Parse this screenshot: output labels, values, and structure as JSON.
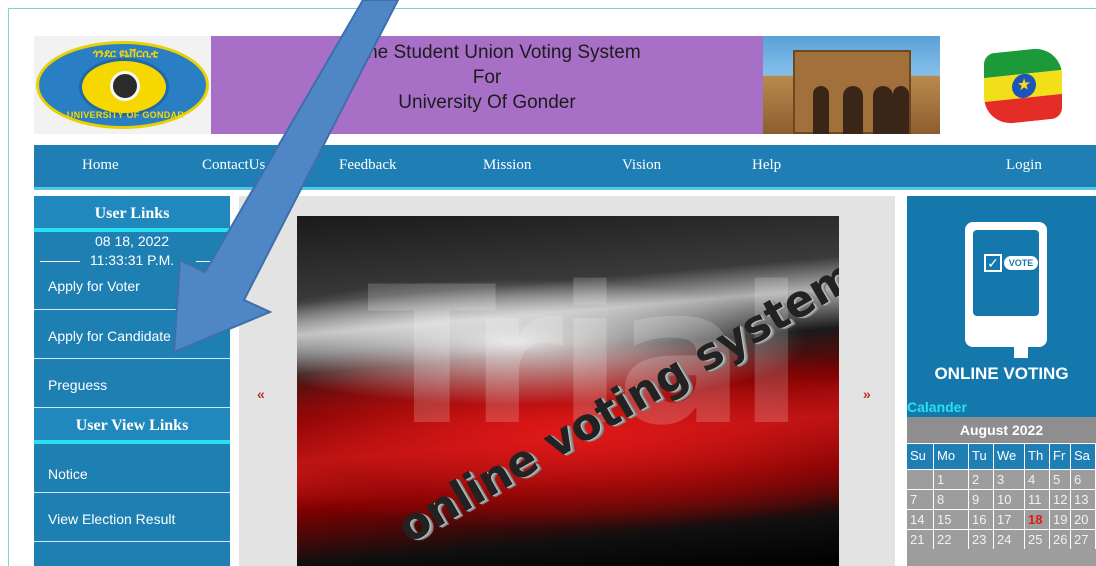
{
  "header": {
    "logo_top_text": "ጎንደር ዩኒቨርሲቲ",
    "logo_bottom_text": "UNIVERSITY OF GONDAR",
    "title_line1": "Online Student Union Voting System",
    "title_line2": "For",
    "title_line3": "University Of Gonder"
  },
  "nav": {
    "home": "Home",
    "contact": "ContactUs",
    "feedback": "Feedback",
    "mission": "Mission",
    "vision": "Vision",
    "help": "Help",
    "login": "Login"
  },
  "sidebar": {
    "user_links_heading": "User Links",
    "date": "08 18, 2022",
    "time": "11:33:31 P.M.",
    "items": [
      {
        "label": "Apply for Voter"
      },
      {
        "label": "Apply for Candidate"
      },
      {
        "label": "Preguess"
      }
    ],
    "view_links_heading": "User View Links",
    "view_items": [
      {
        "label": "Notice"
      },
      {
        "label": "View Election Result"
      }
    ]
  },
  "slideshow": {
    "prev": "«",
    "next": "»",
    "watermark": "Trial",
    "caption": "online voting system"
  },
  "vote_panel": {
    "badge": "VOTE",
    "caption": "ONLINE VOTING"
  },
  "calendar": {
    "label": "Calander",
    "month": "August 2022",
    "weekdays": [
      "Su",
      "Mo",
      "Tu",
      "We",
      "Th",
      "Fr",
      "Sa"
    ],
    "weeks": [
      [
        "",
        "1",
        "2",
        "3",
        "4",
        "5",
        "6"
      ],
      [
        "7",
        "8",
        "9",
        "10",
        "11",
        "12",
        "13"
      ],
      [
        "14",
        "15",
        "16",
        "17",
        "18",
        "19",
        "20"
      ],
      [
        "21",
        "22",
        "23",
        "24",
        "25",
        "26",
        "27"
      ]
    ],
    "today": "18"
  },
  "colors": {
    "nav": "#1f7fb4",
    "accent": "#27e0f0",
    "banner": "#a86fc7",
    "arrow": "#4f86c6"
  }
}
